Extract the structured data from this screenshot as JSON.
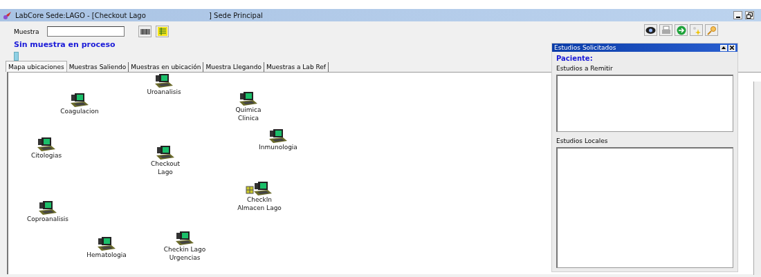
{
  "window": {
    "title": "LabCore Sede:LAGO - [Checkout Lago",
    "title_suffix": "] Sede Principal"
  },
  "toolbar": {
    "sample_label": "Muestra",
    "status": "Sin muestra en proceso"
  },
  "tabs": [
    {
      "label": "Mapa ubicaciones",
      "selected": true
    },
    {
      "label": "Muestras Saliendo",
      "selected": false
    },
    {
      "label": "Muestras en ubicación",
      "selected": false
    },
    {
      "label": "Muestra Llegando",
      "selected": false
    },
    {
      "label": "Muestras a Lab Ref",
      "selected": false
    }
  ],
  "map": {
    "nodes": [
      {
        "label": "Uroanalisis",
        "kind": "computer"
      },
      {
        "label": "Coagulacion",
        "kind": "computer"
      },
      {
        "label": "Quimica\nClinica",
        "kind": "computer"
      },
      {
        "label": "Inmunologia",
        "kind": "computer"
      },
      {
        "label": "Citologias",
        "kind": "computer"
      },
      {
        "label": "Checkout\nLago",
        "kind": "computer"
      },
      {
        "label": "CheckIn\nAlmacen Lago",
        "kind": "storage"
      },
      {
        "label": "Coproanalisis",
        "kind": "computer"
      },
      {
        "label": "Hematologia",
        "kind": "computer"
      },
      {
        "label": "Checkin Lago\nUrgencias",
        "kind": "computer"
      }
    ]
  },
  "panel": {
    "title": "Estudios Solicitados",
    "patient_label": "Paciente:",
    "remit_label": "Estudios a Remitir",
    "local_label": "Estudios Locales"
  }
}
